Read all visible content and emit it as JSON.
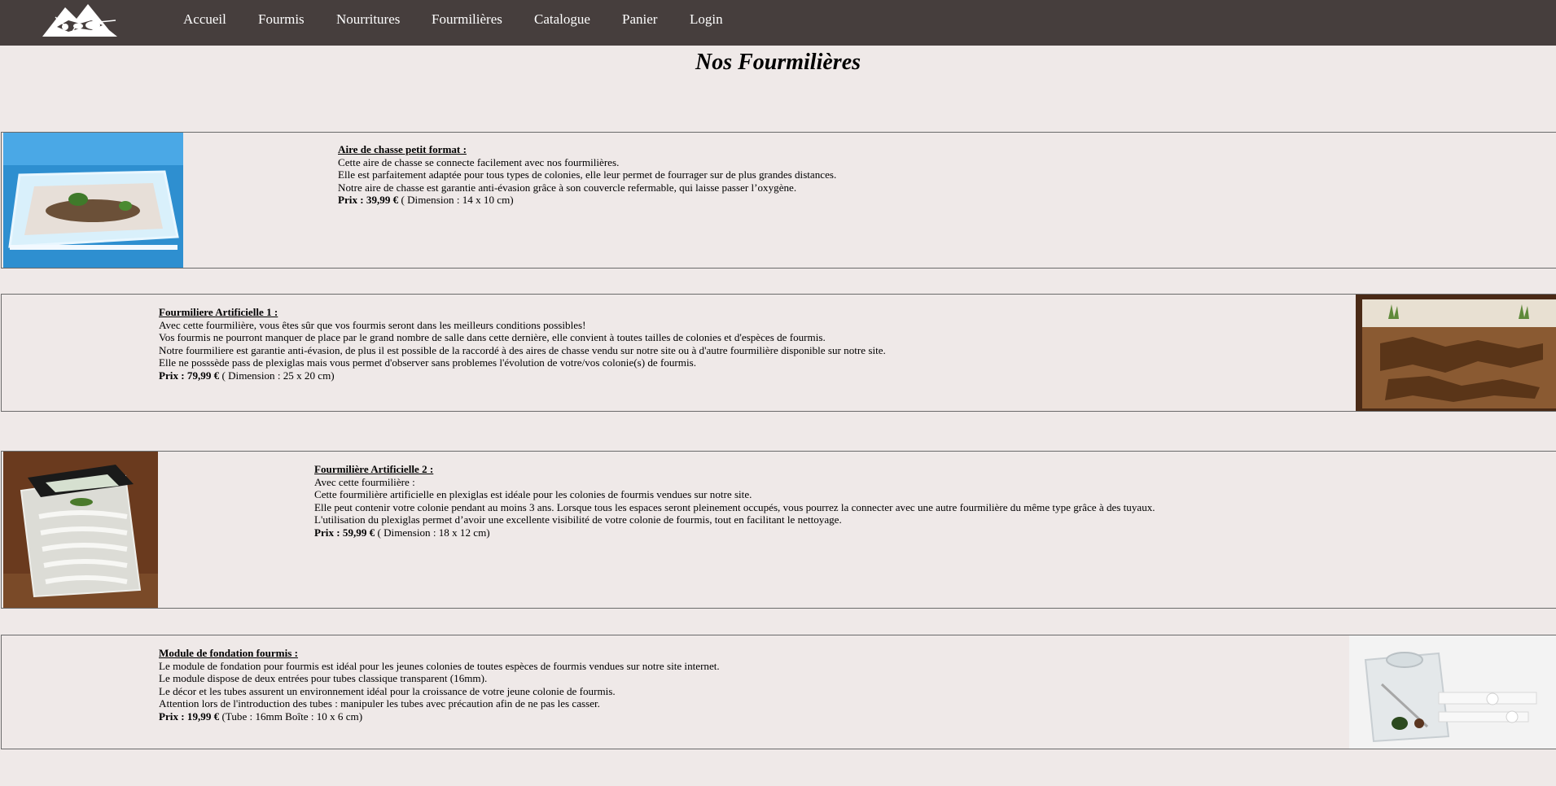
{
  "nav": {
    "logo_icon": "ant-mountain-logo",
    "items": [
      "Accueil",
      "Fourmis",
      "Nourritures",
      "Fourmilières",
      "Catalogue",
      "Panier",
      "Login"
    ]
  },
  "page": {
    "title": "Nos Fourmilières"
  },
  "products": [
    {
      "name": "Aire de chasse petit format :",
      "lines": [
        "Cette aire de chasse se connecte facilement avec nos fourmilières.",
        "Elle est parfaitement adaptée pour tous types de colonies, elle leur permet de fourrager sur de plus grandes distances.",
        "Notre aire de chasse est garantie anti-évasion grâce à son couvercle refermable, qui laisse passer l’oxygène."
      ],
      "price_label": "Prix : 39,99 €",
      "price_detail": " ( Dimension : 14 x 10 cm)",
      "image_icon": "plexiglass-hunting-area-image"
    },
    {
      "name": "Fourmiliere Artificielle 1 :",
      "lines": [
        "Avec cette fourmilière, vous êtes sûr que vos fourmis seront dans les meilleurs conditions possibles!",
        "Vos fourmis ne pourront manquer de place par le grand nombre de salle dans cette dernière, elle convient à toutes tailles de colonies et d'espèces de fourmis.",
        "Notre fourmiliere est garantie anti-évasion, de plus il est possible de la raccordé à des aires de chasse vendu sur notre site ou à d'autre fourmilière disponible sur notre site.",
        "Elle ne posssède pass de plexiglas mais vous permet d'observer sans problemes l'évolution de votre/vos colonie(s) de fourmis."
      ],
      "price_label": "Prix : 79,99 €",
      "price_detail": " ( Dimension : 25 x 20 cm)",
      "image_icon": "sand-formicarium-image"
    },
    {
      "name": "Fourmilière Artificielle 2 :",
      "lines": [
        "Avec cette fourmilière :",
        "Cette fourmilière artificielle en plexiglas est idéale pour les colonies de fourmis vendues sur notre site.",
        "Elle peut contenir votre colonie pendant au moins 3 ans. Lorsque tous les espaces seront pleinement occupés, vous pourrez la connecter avec une autre fourmilière du même type grâce à des tuyaux.",
        "L'utilisation du plexiglas permet d’avoir une excellente visibilité de votre colonie de fourmis, tout en facilitant le nettoyage."
      ],
      "price_label": "Prix : 59,99 €",
      "price_detail": " ( Dimension : 18 x 12 cm)",
      "image_icon": "plexiglass-formicarium-image"
    },
    {
      "name": "Module de fondation fourmis :",
      "lines": [
        "Le module de fondation pour fourmis est idéal pour les jeunes colonies de toutes espèces de fourmis vendues sur notre site internet.",
        "Le module dispose de deux entrées pour tubes classique transparent (16mm).",
        "Le décor et les tubes assurent un environnement idéal pour la croissance de votre jeune colonie de fourmis.",
        "Attention lors de l'introduction des tubes : manipuler les tubes avec précaution afin de ne pas les casser."
      ],
      "price_label": "Prix : 19,99 €",
      "price_detail": " (Tube : 16mm Boîte : 10 x 6 cm)",
      "image_icon": "foundation-module-image"
    }
  ]
}
